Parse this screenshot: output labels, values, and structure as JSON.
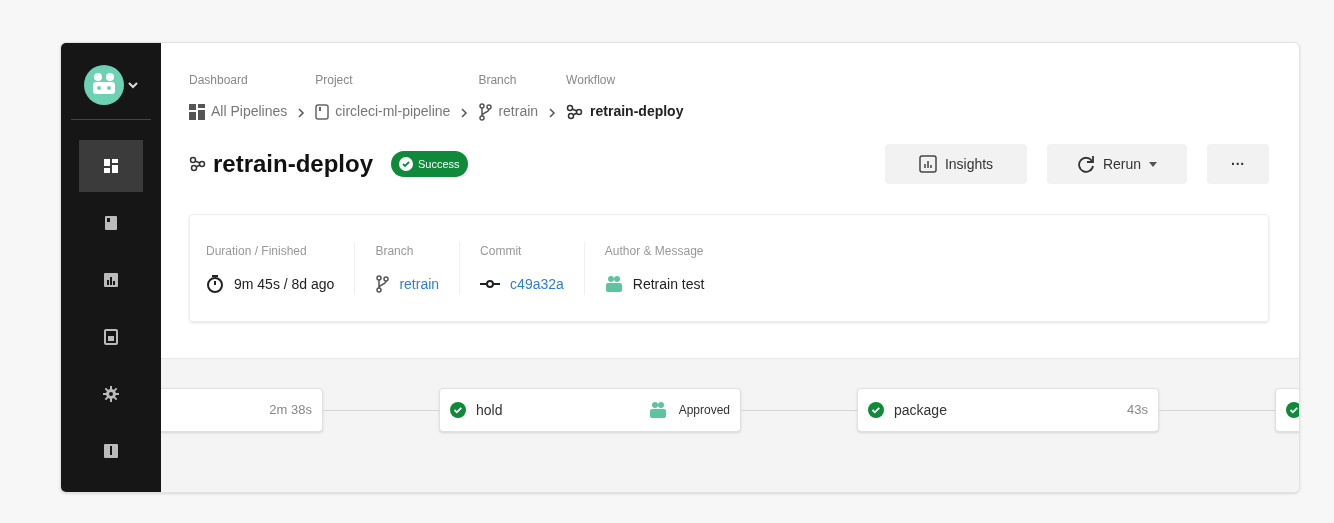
{
  "sidebar": {
    "items": [
      {
        "selected": true
      },
      {
        "selected": false
      },
      {
        "selected": false
      },
      {
        "selected": false
      },
      {
        "selected": false
      },
      {
        "selected": false
      }
    ]
  },
  "breadcrumbs": [
    {
      "label": "Dashboard",
      "value": "All Pipelines"
    },
    {
      "label": "Project",
      "value": "circleci-ml-pipeline"
    },
    {
      "label": "Branch",
      "value": "retrain"
    },
    {
      "label": "Workflow",
      "value": "retrain-deploy"
    }
  ],
  "title": "retrain-deploy",
  "status_badge": {
    "text": "Success"
  },
  "buttons": [
    {
      "kind": "insights",
      "label": "Insights"
    },
    {
      "kind": "rerun",
      "label": "Rerun"
    },
    {
      "kind": "more",
      "label": "···"
    }
  ],
  "details": [
    {
      "label": "Duration / Finished",
      "value": "9m 45s / 8d ago",
      "link": false
    },
    {
      "label": "Branch",
      "value": "retrain",
      "link": true
    },
    {
      "label": "Commit",
      "value": "c49a32a",
      "link": true
    },
    {
      "label": "Author & Message",
      "value": "Retrain test",
      "link": false
    }
  ],
  "jobs": [
    {
      "kind": "partial",
      "duration": "2m 38s"
    },
    {
      "kind": "approval",
      "name": "hold",
      "passed": true,
      "approval": "Approved"
    },
    {
      "kind": "job",
      "name": "package",
      "passed": true,
      "duration": "43s"
    },
    {
      "kind": "edge",
      "passed": true
    }
  ]
}
